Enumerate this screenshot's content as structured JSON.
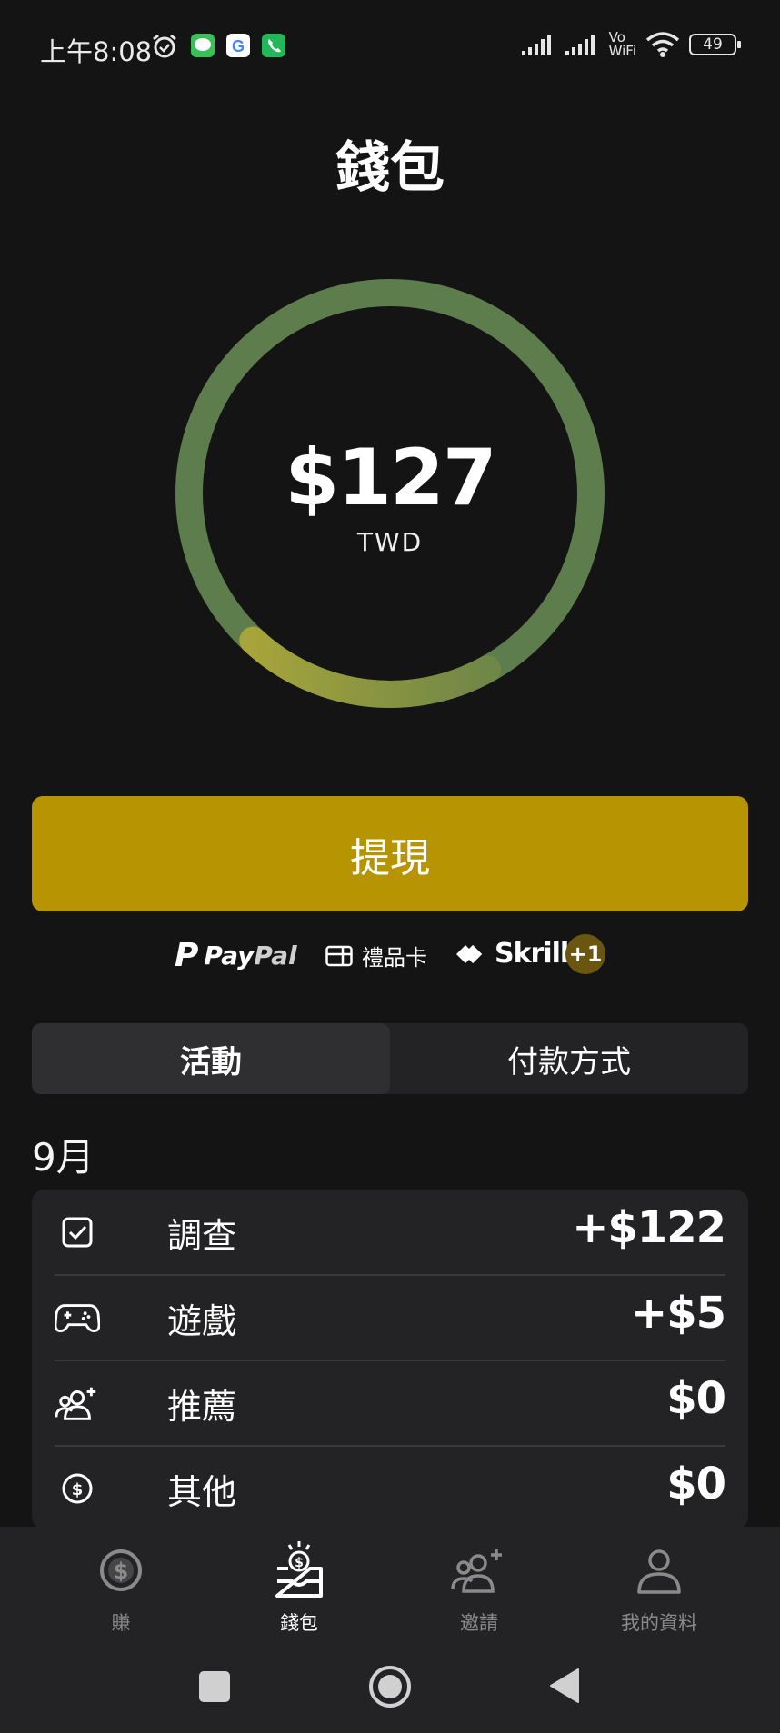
{
  "status_bar": {
    "time": "上午8:08",
    "battery": "49",
    "network_label_top": "Vo",
    "network_label_bottom": "WiFi"
  },
  "page": {
    "title": "錢包"
  },
  "balance": {
    "amount": "$127",
    "currency": "TWD",
    "progress_fraction": 0.2
  },
  "withdraw": {
    "label": "提現"
  },
  "payout_methods": {
    "paypal_a": "Pay",
    "paypal_b": "Pal",
    "giftcard": "禮品卡",
    "skrill": "Skrill",
    "more": "+1"
  },
  "tabs": {
    "activity": "活動",
    "payment_methods": "付款方式"
  },
  "month": "9月",
  "activities": [
    {
      "icon": "checkbox-icon",
      "label": "調查",
      "value": "+$122"
    },
    {
      "icon": "gamepad-icon",
      "label": "遊戲",
      "value": "+$5"
    },
    {
      "icon": "add-friend-icon",
      "label": "推薦",
      "value": "$0"
    },
    {
      "icon": "dollar-circle-icon",
      "label": "其他",
      "value": "$0"
    }
  ],
  "bottom_nav": {
    "earn": "賺",
    "wallet": "錢包",
    "invite": "邀請",
    "profile": "我的資料"
  },
  "colors": {
    "accent": "#b79402",
    "background": "#141414",
    "card": "#232325",
    "ring_green": "#5e7d4d",
    "ring_gold": "#9a9838"
  }
}
